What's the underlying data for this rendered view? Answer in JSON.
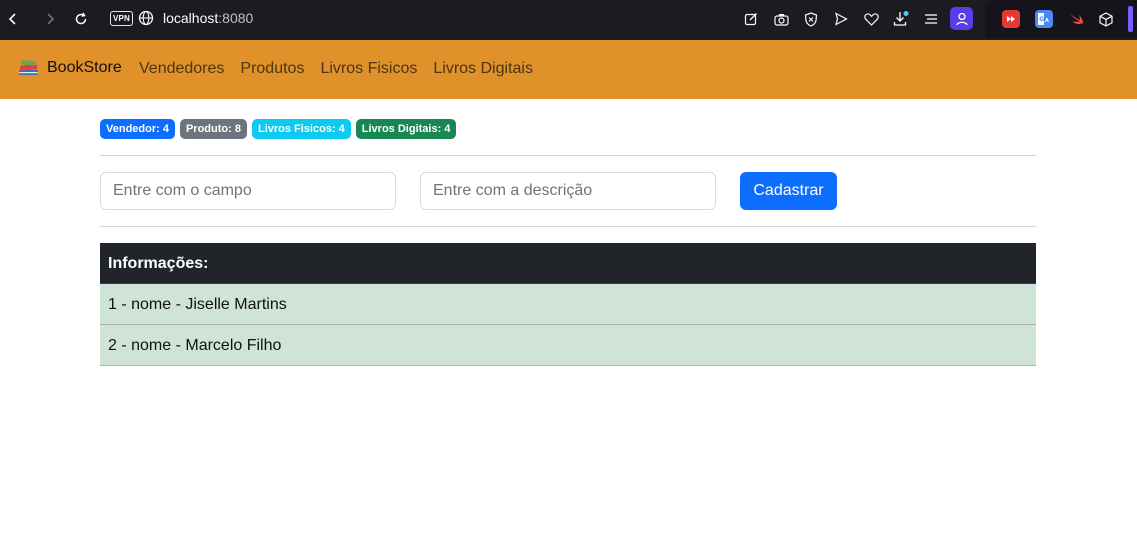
{
  "browser": {
    "url_host": "localhost",
    "url_port": ":8080",
    "vpn_label": "VPN"
  },
  "navbar": {
    "brand": "BookStore",
    "links": [
      "Vendedores",
      "Produtos",
      "Livros Fisicos",
      "Livros Digitais"
    ],
    "bg_color": "#e0912a"
  },
  "badges": [
    {
      "label": "Vendedor: 4",
      "color": "#0d6efd"
    },
    {
      "label": "Produto: 8",
      "color": "#6c757d"
    },
    {
      "label": "Livros Fisicos: 4",
      "color": "#0dcaf0"
    },
    {
      "label": "Livros Digitais: 4",
      "color": "#198754"
    }
  ],
  "form": {
    "campo_placeholder": "Entre com o campo",
    "descricao_placeholder": "Entre com a descrição",
    "submit_label": "Cadastrar"
  },
  "table": {
    "header": "Informações:",
    "rows": [
      "1 - nome - Jiselle Martins",
      "2 - nome - Marcelo Filho"
    ]
  }
}
